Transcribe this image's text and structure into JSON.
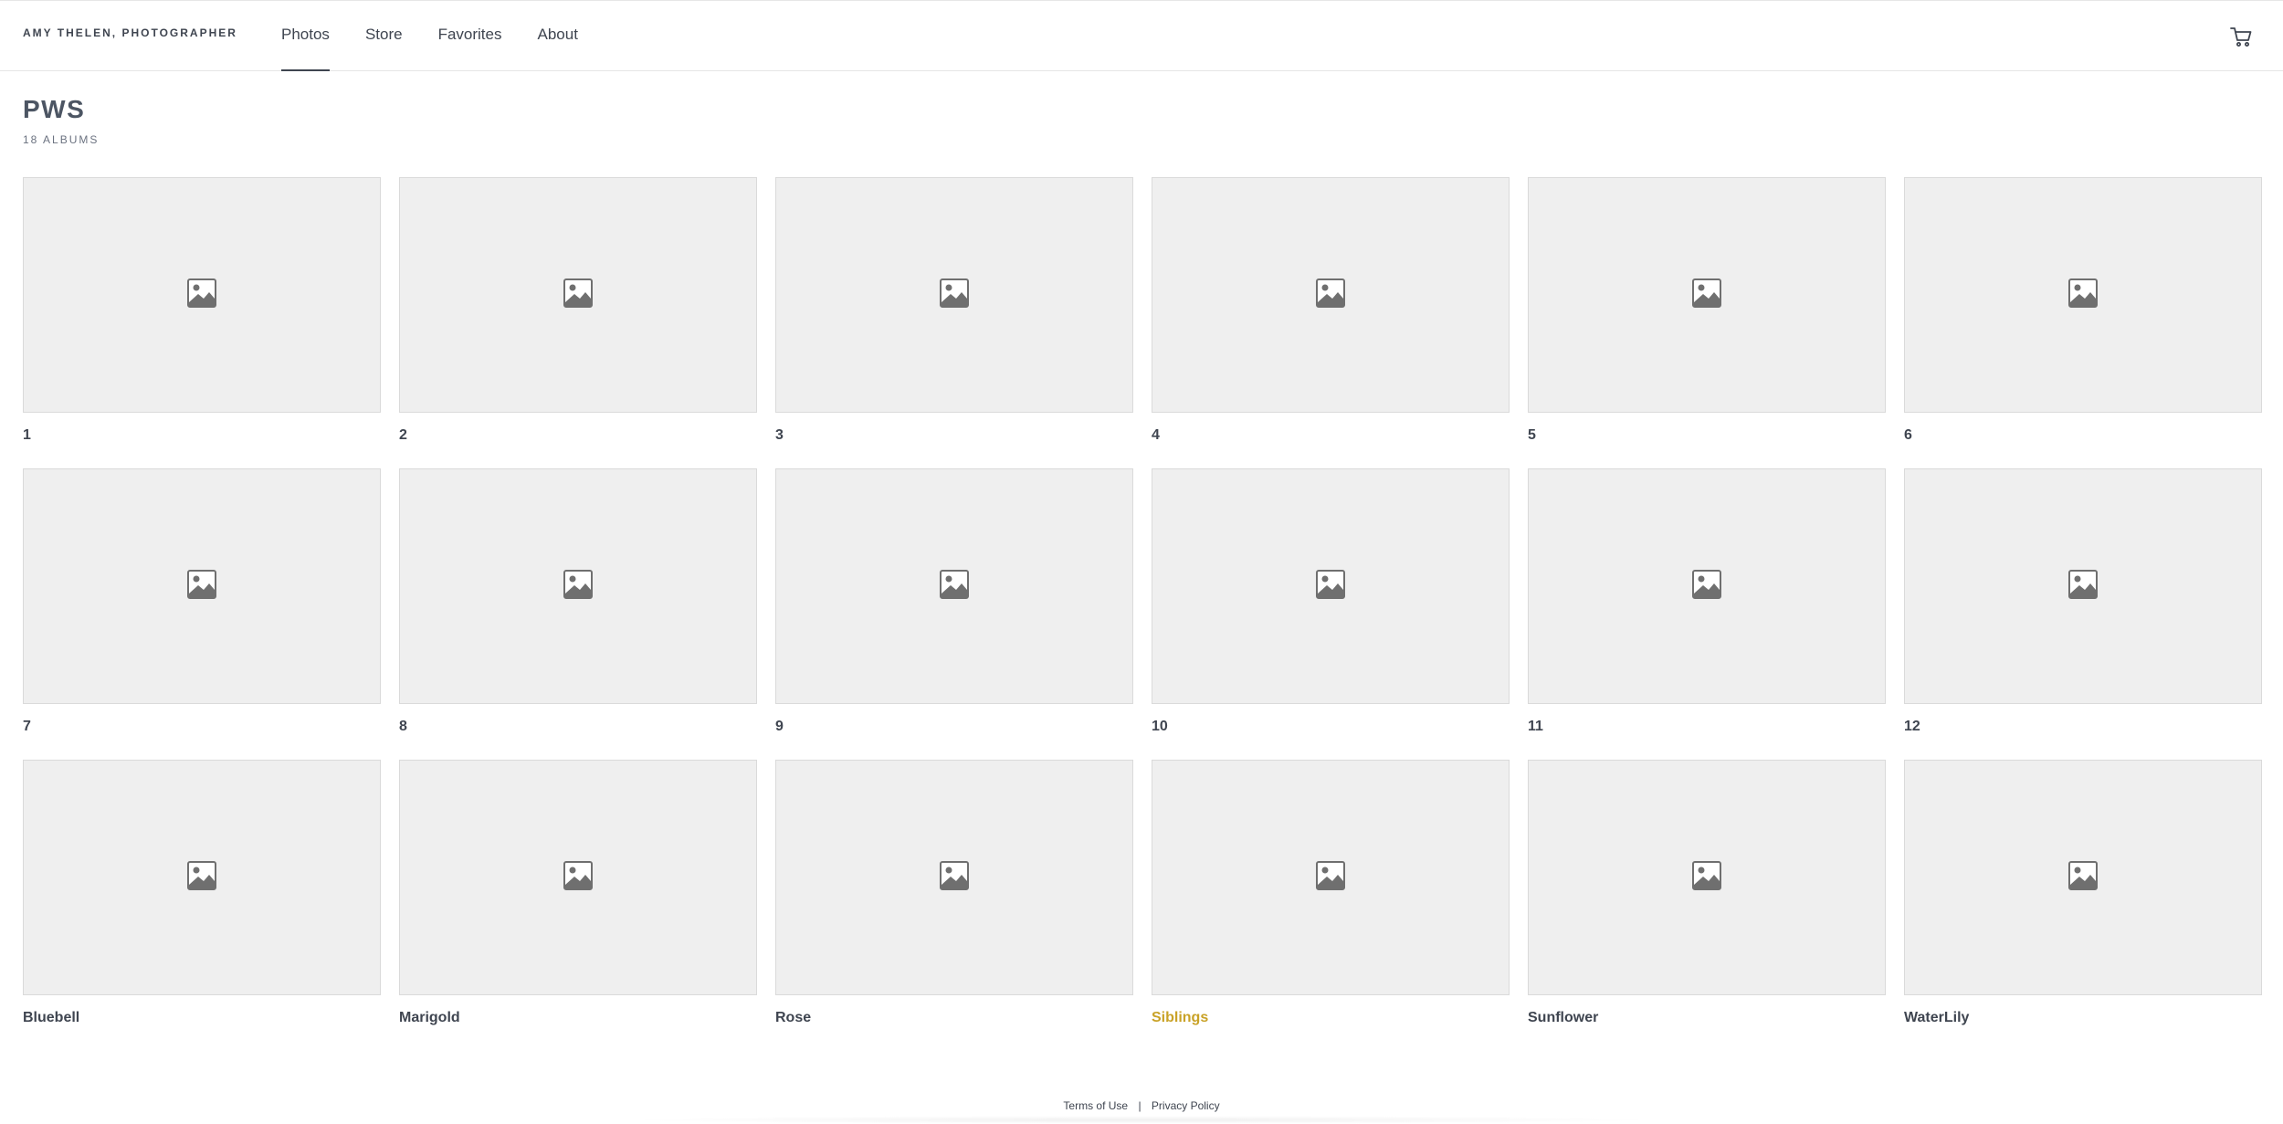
{
  "header": {
    "brand": "AMY THELEN, PHOTOGRAPHER",
    "nav": [
      {
        "label": "Photos",
        "active": true
      },
      {
        "label": "Store",
        "active": false
      },
      {
        "label": "Favorites",
        "active": false
      },
      {
        "label": "About",
        "active": false
      }
    ],
    "cart_icon": "cart-icon"
  },
  "page": {
    "title": "PWS",
    "album_count": "18 ALBUMS"
  },
  "albums": [
    {
      "name": "1",
      "icon": "image-placeholder-icon"
    },
    {
      "name": "2",
      "icon": "image-placeholder-icon"
    },
    {
      "name": "3",
      "icon": "image-placeholder-icon"
    },
    {
      "name": "4",
      "icon": "image-placeholder-icon"
    },
    {
      "name": "5",
      "icon": "image-placeholder-icon"
    },
    {
      "name": "6",
      "icon": "image-placeholder-icon"
    },
    {
      "name": "7",
      "icon": "image-placeholder-icon"
    },
    {
      "name": "8",
      "icon": "image-placeholder-icon"
    },
    {
      "name": "9",
      "icon": "image-placeholder-icon"
    },
    {
      "name": "10",
      "icon": "image-placeholder-icon"
    },
    {
      "name": "11",
      "icon": "image-placeholder-icon"
    },
    {
      "name": "12",
      "icon": "image-placeholder-icon"
    },
    {
      "name": "Bluebell",
      "icon": "image-placeholder-icon"
    },
    {
      "name": "Marigold",
      "icon": "image-placeholder-icon"
    },
    {
      "name": "Rose",
      "icon": "image-placeholder-icon"
    },
    {
      "name": "Siblings",
      "icon": "image-placeholder-icon",
      "highlight_color": "#c9a227"
    },
    {
      "name": "Sunflower",
      "icon": "image-placeholder-icon"
    },
    {
      "name": "WaterLily",
      "icon": "image-placeholder-icon"
    }
  ],
  "footer": {
    "terms": "Terms of Use",
    "separator": "|",
    "privacy": "Privacy Policy"
  },
  "colors": {
    "text": "#3f4550",
    "thumb_bg": "#efefef",
    "accent_hover": "#c9a227"
  }
}
